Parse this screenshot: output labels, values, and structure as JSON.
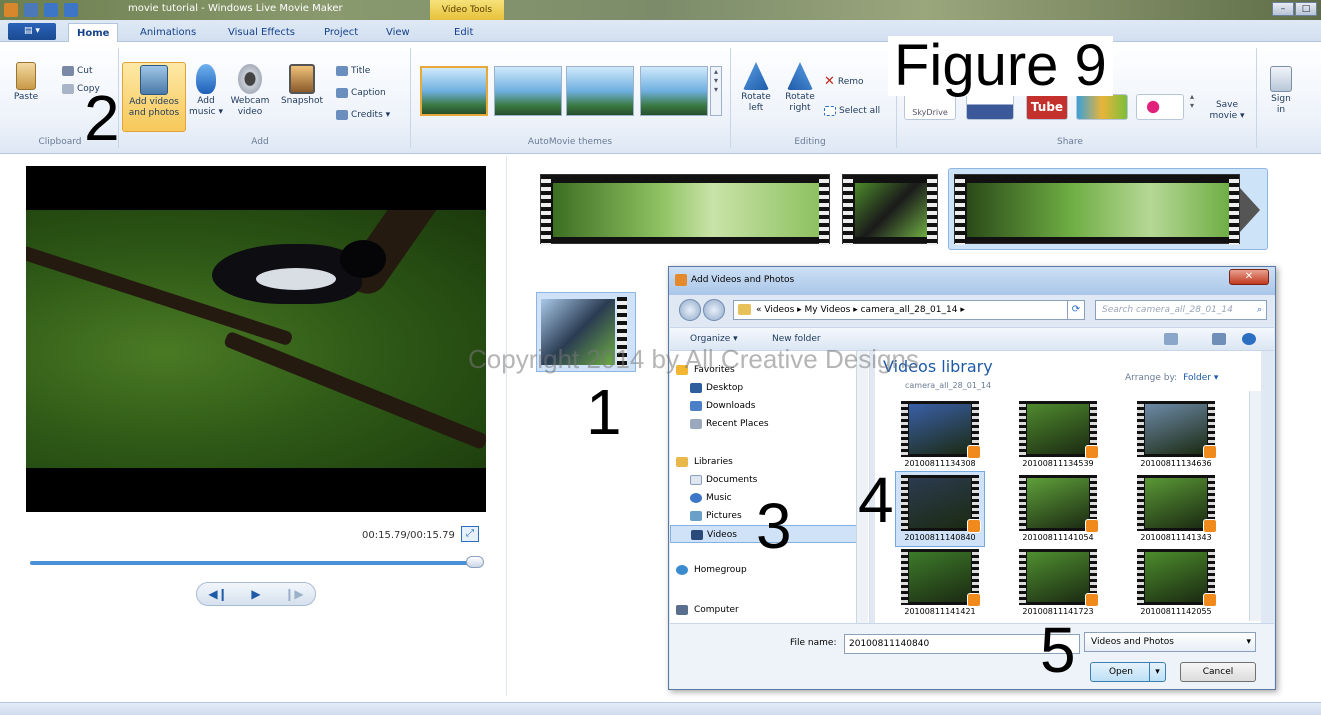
{
  "window": {
    "title": "movie tutorial - Windows Live Movie Maker",
    "contextual_tab_group": "Video Tools",
    "controls": [
      "–",
      "□"
    ]
  },
  "ribbon_tabs": [
    {
      "label": "Home",
      "active": true
    },
    {
      "label": "Animations",
      "active": false
    },
    {
      "label": "Visual Effects",
      "active": false
    },
    {
      "label": "Project",
      "active": false
    },
    {
      "label": "View",
      "active": false
    },
    {
      "label": "Edit",
      "active": false
    }
  ],
  "ribbon": {
    "clipboard": {
      "paste": "Paste",
      "cut": "Cut",
      "copy": "Copy",
      "group": "Clipboard"
    },
    "add": {
      "add_videos_line1": "Add videos",
      "add_videos_line2": "and photos",
      "add_music_line1": "Add",
      "add_music_line2": "music ▾",
      "webcam_line1": "Webcam",
      "webcam_line2": "video",
      "snapshot": "Snapshot",
      "title": "Title",
      "caption": "Caption",
      "credits": "Credits ▾",
      "group": "Add"
    },
    "themes": {
      "group": "AutoMovie themes"
    },
    "editing": {
      "rotate_left_1": "Rotate",
      "rotate_left_2": "left",
      "rotate_right_1": "Rotate",
      "rotate_right_2": "right",
      "remove": "Remo",
      "select_all": "Select all",
      "group": "Editing"
    },
    "share": {
      "skydrive": "SkyDrive",
      "youtube": "Tube",
      "save_movie_1": "Save",
      "save_movie_2": "movie ▾",
      "group": "Share"
    },
    "sign_in_1": "Sign",
    "sign_in_2": "in"
  },
  "annotations": {
    "figure": "Figure 9",
    "n1": "1",
    "n2": "2",
    "n3": "3",
    "n4": "4",
    "n5": "5",
    "watermark": "Copyright 2014 by All Creative Designs"
  },
  "preview": {
    "time": "00:15.79/00:15.79",
    "progress_fraction": 1.0
  },
  "dialog": {
    "title": "Add Videos and Photos",
    "close": "✕",
    "path": "« Videos ▸ My Videos ▸ camera_all_28_01_14 ▸",
    "search_placeholder": "Search camera_all_28_01_14",
    "organize": "Organize ▾",
    "new_folder": "New folder",
    "nav": {
      "favorites": "Favorites",
      "desktop": "Desktop",
      "downloads": "Downloads",
      "recent_places": "Recent Places",
      "libraries": "Libraries",
      "documents": "Documents",
      "music": "Music",
      "pictures": "Pictures",
      "videos": "Videos",
      "homegroup": "Homegroup",
      "computer": "Computer"
    },
    "library_title": "Videos library",
    "library_sub": "camera_all_28_01_14",
    "arrange_by": "Arrange by:",
    "arrange_value": "Folder ▾",
    "files": [
      {
        "name": "20100811134308",
        "color": "#3a5fa8"
      },
      {
        "name": "20100811134539",
        "color": "#4f8a2e"
      },
      {
        "name": "20100811134636",
        "color": "#6d8aa8"
      },
      {
        "name": "20100811140840",
        "color": "#2c3b4f"
      },
      {
        "name": "20100811141054",
        "color": "#5fa03a"
      },
      {
        "name": "20100811141343",
        "color": "#5a9836"
      },
      {
        "name": "20100811141421",
        "color": "#3d7a2a"
      },
      {
        "name": "20100811141723",
        "color": "#4f8f30"
      },
      {
        "name": "20100811142055",
        "color": "#4c8c2c"
      }
    ],
    "selected_index": 3,
    "file_name_label": "File name:",
    "file_name_value": "20100811140840",
    "filter": "Videos and Photos",
    "open": "Open",
    "cancel": "Cancel"
  },
  "colors": {
    "accent": "#1e5aa8",
    "selection": "#cfe2f7",
    "highlight": "#f7c85a"
  }
}
